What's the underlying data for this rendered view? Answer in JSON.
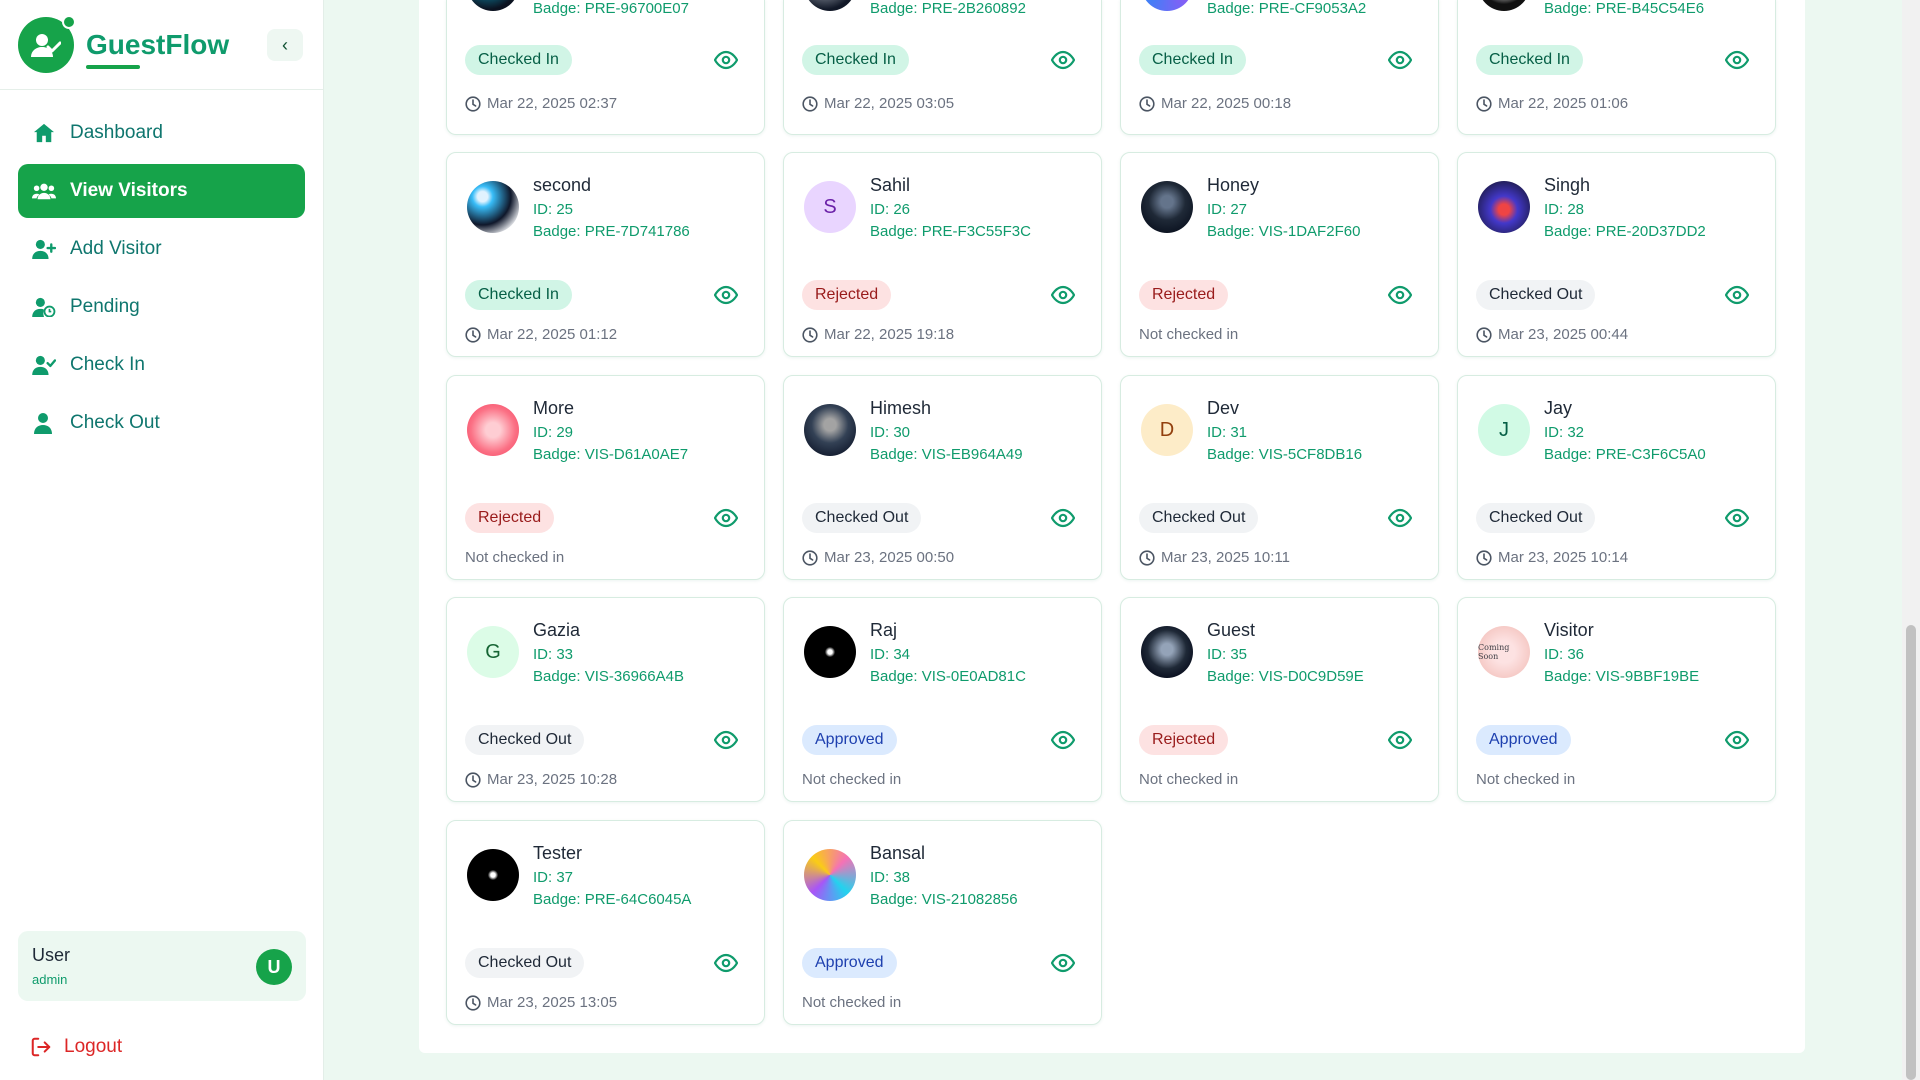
{
  "app": {
    "name": "GuestFlow"
  },
  "nav": [
    {
      "label": "Dashboard",
      "icon": "home-icon"
    },
    {
      "label": "View Visitors",
      "icon": "users-icon",
      "active": true
    },
    {
      "label": "Add Visitor",
      "icon": "user-plus-icon"
    },
    {
      "label": "Pending",
      "icon": "user-clock-icon"
    },
    {
      "label": "Check In",
      "icon": "user-check-icon"
    },
    {
      "label": "Check Out",
      "icon": "user-out-icon"
    }
  ],
  "user": {
    "name": "User",
    "role": "admin",
    "initial": "U"
  },
  "logout_label": "Logout",
  "visitors": [
    {
      "name": "",
      "id": "",
      "badge": "Badge: PRE-96700E07",
      "status": "Checked In",
      "time": "Mar 22, 2025 02:37"
    },
    {
      "name": "",
      "id": "",
      "badge": "Badge: PRE-2B260892",
      "status": "Checked In",
      "time": "Mar 22, 2025 03:05"
    },
    {
      "name": "",
      "id": "",
      "badge": "Badge: PRE-CF9053A2",
      "status": "Checked In",
      "time": "Mar 22, 2025 00:18"
    },
    {
      "name": "",
      "id": "",
      "badge": "Badge: PRE-B45C54E6",
      "status": "Checked In",
      "time": "Mar 22, 2025 01:06"
    },
    {
      "name": "second",
      "id": "ID: 25",
      "badge": "Badge: PRE-7D741786",
      "status": "Checked In",
      "time": "Mar 22, 2025 01:12"
    },
    {
      "name": "Sahil",
      "id": "ID: 26",
      "badge": "Badge: PRE-F3C55F3C",
      "status": "Rejected",
      "time": "Mar 22, 2025 19:18",
      "initial": "S"
    },
    {
      "name": "Honey",
      "id": "ID: 27",
      "badge": "Badge: VIS-1DAF2F60",
      "status": "Rejected",
      "time": "Not checked in"
    },
    {
      "name": "Singh",
      "id": "ID: 28",
      "badge": "Badge: PRE-20D37DD2",
      "status": "Checked Out",
      "time": "Mar 23, 2025 00:44"
    },
    {
      "name": "More",
      "id": "ID: 29",
      "badge": "Badge: VIS-D61A0AE7",
      "status": "Rejected",
      "time": "Not checked in"
    },
    {
      "name": "Himesh",
      "id": "ID: 30",
      "badge": "Badge: VIS-EB964A49",
      "status": "Checked Out",
      "time": "Mar 23, 2025 00:50"
    },
    {
      "name": "Dev",
      "id": "ID: 31",
      "badge": "Badge: VIS-5CF8DB16",
      "status": "Checked Out",
      "time": "Mar 23, 2025 10:11",
      "initial": "D"
    },
    {
      "name": "Jay",
      "id": "ID: 32",
      "badge": "Badge: PRE-C3F6C5A0",
      "status": "Checked Out",
      "time": "Mar 23, 2025 10:14",
      "initial": "J"
    },
    {
      "name": "Gazia",
      "id": "ID: 33",
      "badge": "Badge: VIS-36966A4B",
      "status": "Checked Out",
      "time": "Mar 23, 2025 10:28",
      "initial": "G"
    },
    {
      "name": "Raj",
      "id": "ID: 34",
      "badge": "Badge: VIS-0E0AD81C",
      "status": "Approved",
      "time": "Not checked in"
    },
    {
      "name": "Guest",
      "id": "ID: 35",
      "badge": "Badge: VIS-D0C9D59E",
      "status": "Rejected",
      "time": "Not checked in"
    },
    {
      "name": "Visitor",
      "id": "ID: 36",
      "badge": "Badge: VIS-9BBF19BE",
      "status": "Approved",
      "time": "Not checked in",
      "avatar_text": "Coming Soon"
    },
    {
      "name": "Tester",
      "id": "ID: 37",
      "badge": "Badge: PRE-64C6045A",
      "status": "Checked Out",
      "time": "Mar 23, 2025 13:05"
    },
    {
      "name": "Bansal",
      "id": "ID: 38",
      "badge": "Badge: VIS-21082856",
      "status": "Approved",
      "time": "Not checked in"
    }
  ],
  "colors": {
    "primary": "#16a34a",
    "brand_text": "#0f9b6c",
    "checked_in_bg": "#d1f5e6",
    "rejected_bg": "#fde2e2",
    "approved_bg": "#dbeafe",
    "checked_out_bg": "#f1f3f5"
  }
}
